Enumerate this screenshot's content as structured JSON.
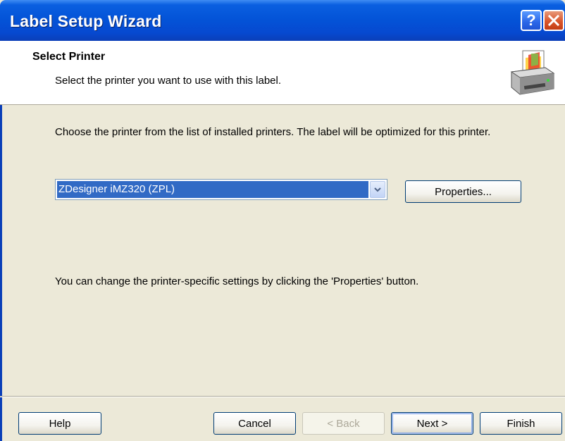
{
  "window": {
    "title": "Label Setup Wizard",
    "help_icon": "question-mark-icon",
    "close_icon": "close-icon"
  },
  "header": {
    "title": "Select Printer",
    "subtitle": "Select the printer you want to use with this label.",
    "icon": "printer-icon"
  },
  "content": {
    "description": "Choose the printer from the list of installed printers. The label will be optimized for this printer.",
    "printer_select": {
      "value": "ZDesigner iMZ320 (ZPL)"
    },
    "properties_label": "Properties...",
    "note": "You can change the printer-specific settings by clicking the 'Properties' button."
  },
  "footer": {
    "help_label": "Help",
    "cancel_label": "Cancel",
    "back_label": "< Back",
    "next_label": "Next >",
    "finish_label": "Finish"
  },
  "colors": {
    "titlebar": "#0454d8",
    "selection": "#316ac5",
    "dialog_bg": "#ece9d8"
  }
}
